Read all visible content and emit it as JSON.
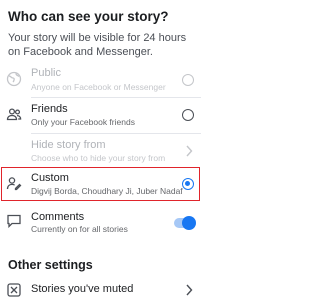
{
  "header": {
    "title": "Who can see your story?",
    "description": "Your story will be visible for 24 hours on Facebook and Messenger."
  },
  "audience_options": [
    {
      "label": "Public",
      "sublabel": "Anyone on Facebook or Messenger",
      "icon": "globe-icon",
      "state": "disabled",
      "selected": false
    },
    {
      "label": "Friends",
      "sublabel": "Only your Facebook friends",
      "icon": "friends-icon",
      "state": "enabled",
      "selected": false
    },
    {
      "label": "Hide story from",
      "sublabel": "Choose who to hide your story from",
      "icon": "",
      "state": "disabled",
      "selected": false
    },
    {
      "label": "Custom",
      "sublabel": "Digvij Borda, Choudhary Ji, Juber Nadaf",
      "icon": "custom-audience-icon",
      "state": "enabled",
      "selected": true
    }
  ],
  "comments": {
    "label": "Comments",
    "sublabel": "Currently on for all stories",
    "icon": "comment-icon",
    "enabled": true
  },
  "other_settings": {
    "title": "Other settings",
    "items": [
      {
        "label": "Stories you've muted",
        "icon": "muted-icon"
      }
    ]
  },
  "colors": {
    "accent": "#1877f2",
    "highlight_border": "#e0242b"
  }
}
